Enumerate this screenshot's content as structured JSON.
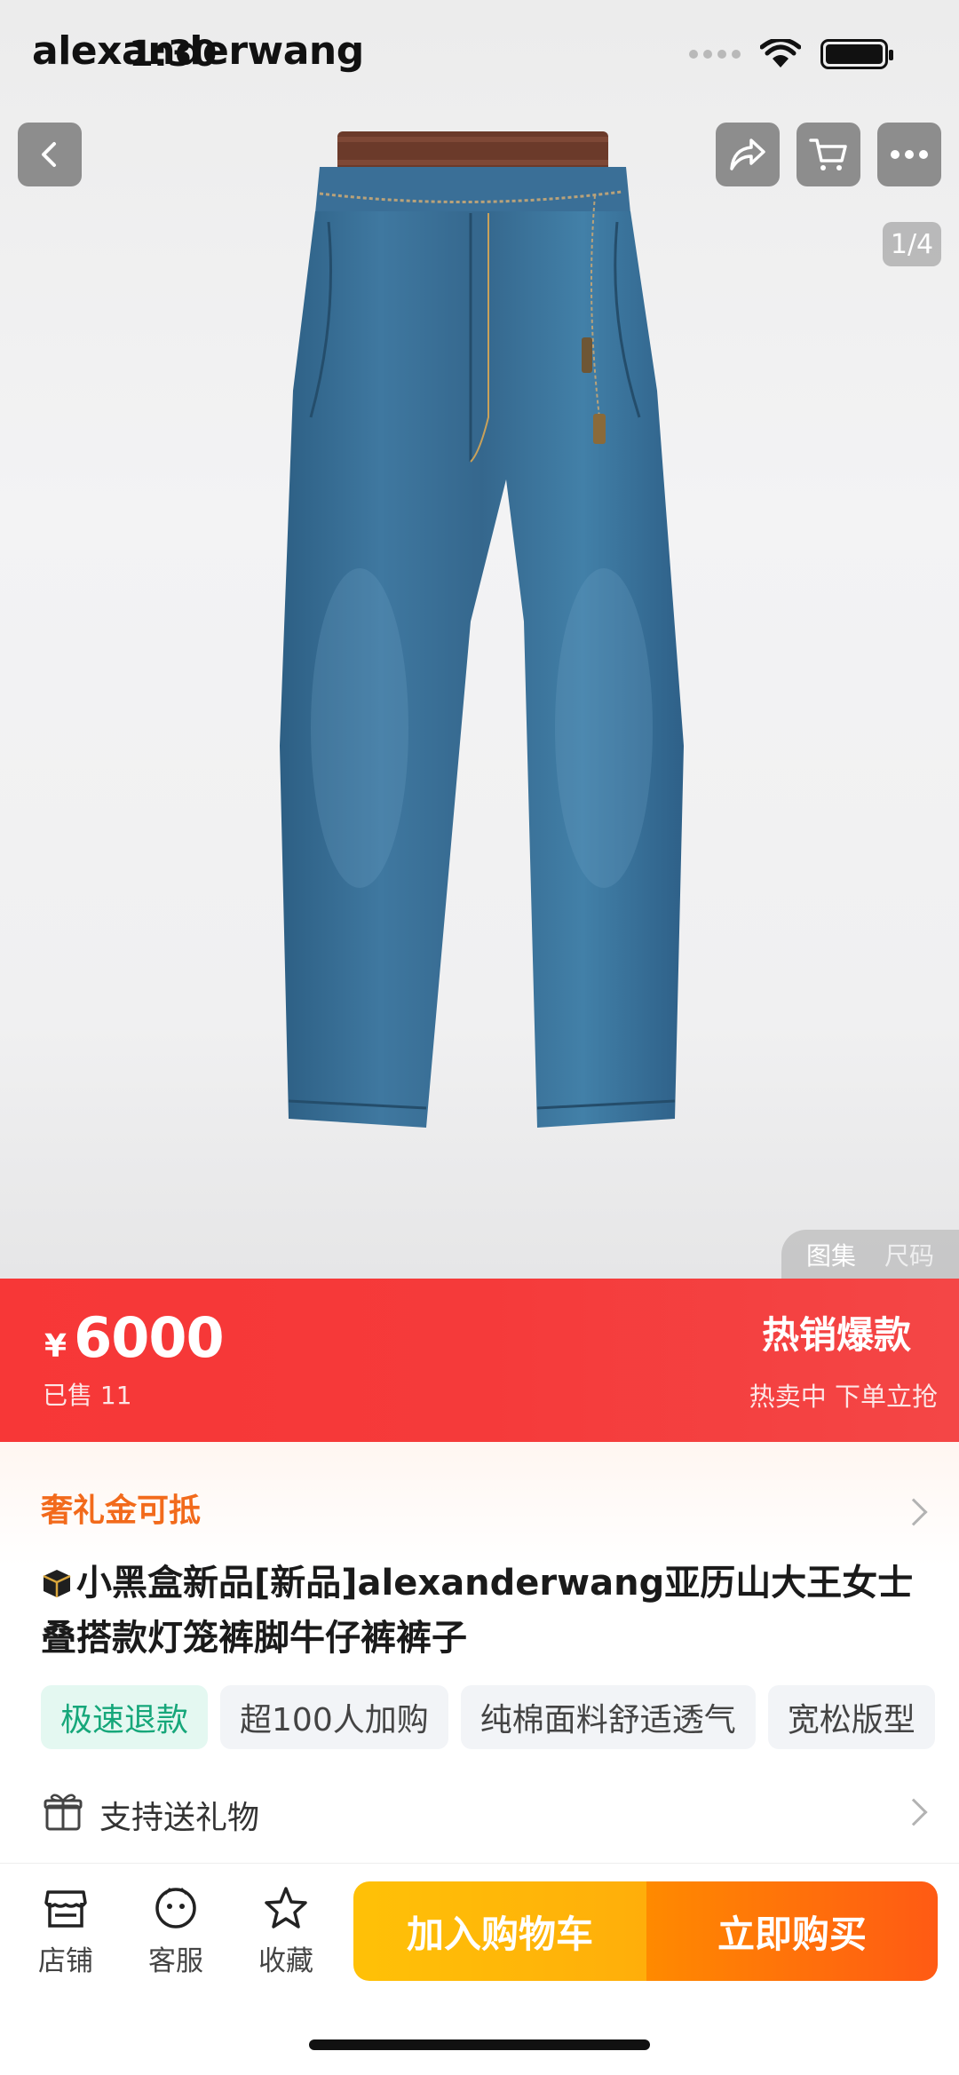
{
  "status_bar": {
    "time": "1:30",
    "brand_overlay": "alexanderwang"
  },
  "hero": {
    "page_indicator": "1/4",
    "gallery_tabs": [
      "图集",
      "尺码"
    ],
    "icons": {
      "back": "back-icon",
      "share": "share-icon",
      "cart": "cart-icon",
      "more": "more-icon"
    }
  },
  "price_banner": {
    "currency": "¥",
    "price": "6000",
    "sold": "已售 11",
    "hot_title": "热销爆款",
    "hot_sub": "热卖中 下单立抢",
    "color": "#f53a3a"
  },
  "coupon": {
    "label": "奢礼金可抵"
  },
  "product": {
    "title": "小黑盒新品[新品]alexanderwang亚历山大王女士叠搭款灯笼裤脚牛仔裤裤子",
    "tags": [
      "极速退款",
      "超100人加购",
      "纯棉面料舒适透气",
      "宽松版型"
    ]
  },
  "gift": {
    "label": "支持送礼物"
  },
  "bottom_bar": {
    "nav": [
      {
        "label": "店铺",
        "icon": "store-icon"
      },
      {
        "label": "客服",
        "icon": "customer-service-icon"
      },
      {
        "label": "收藏",
        "icon": "star-icon"
      }
    ],
    "add_to_cart": "加入购物车",
    "buy_now": "立即购买"
  }
}
